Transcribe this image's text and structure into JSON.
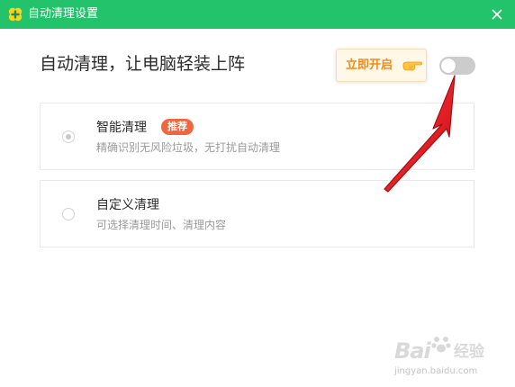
{
  "window": {
    "title": "自动清理设置",
    "app_icon": "clover-plus-icon",
    "close_icon": "close-icon"
  },
  "header": {
    "headline": "自动清理，让电脑轻装上阵"
  },
  "tooltip": {
    "label": "立即开启",
    "icon": "pointing-hand-icon"
  },
  "toggle": {
    "state": "off"
  },
  "options": [
    {
      "title": "智能清理",
      "badge": "推荐",
      "description": "精确识别无风险垃圾，无打扰自动清理",
      "selected": true
    },
    {
      "title": "自定义清理",
      "description": "可选择清理时间、清理内容",
      "selected": false
    }
  ],
  "watermark": {
    "brand": "Bai",
    "word": "经验",
    "url": "jingyan.baidu.com"
  },
  "colors": {
    "titlebar": "#22c36b",
    "tooltip_text": "#f08a1c",
    "badge": "#f0663e",
    "arrow": "#e8141c"
  }
}
